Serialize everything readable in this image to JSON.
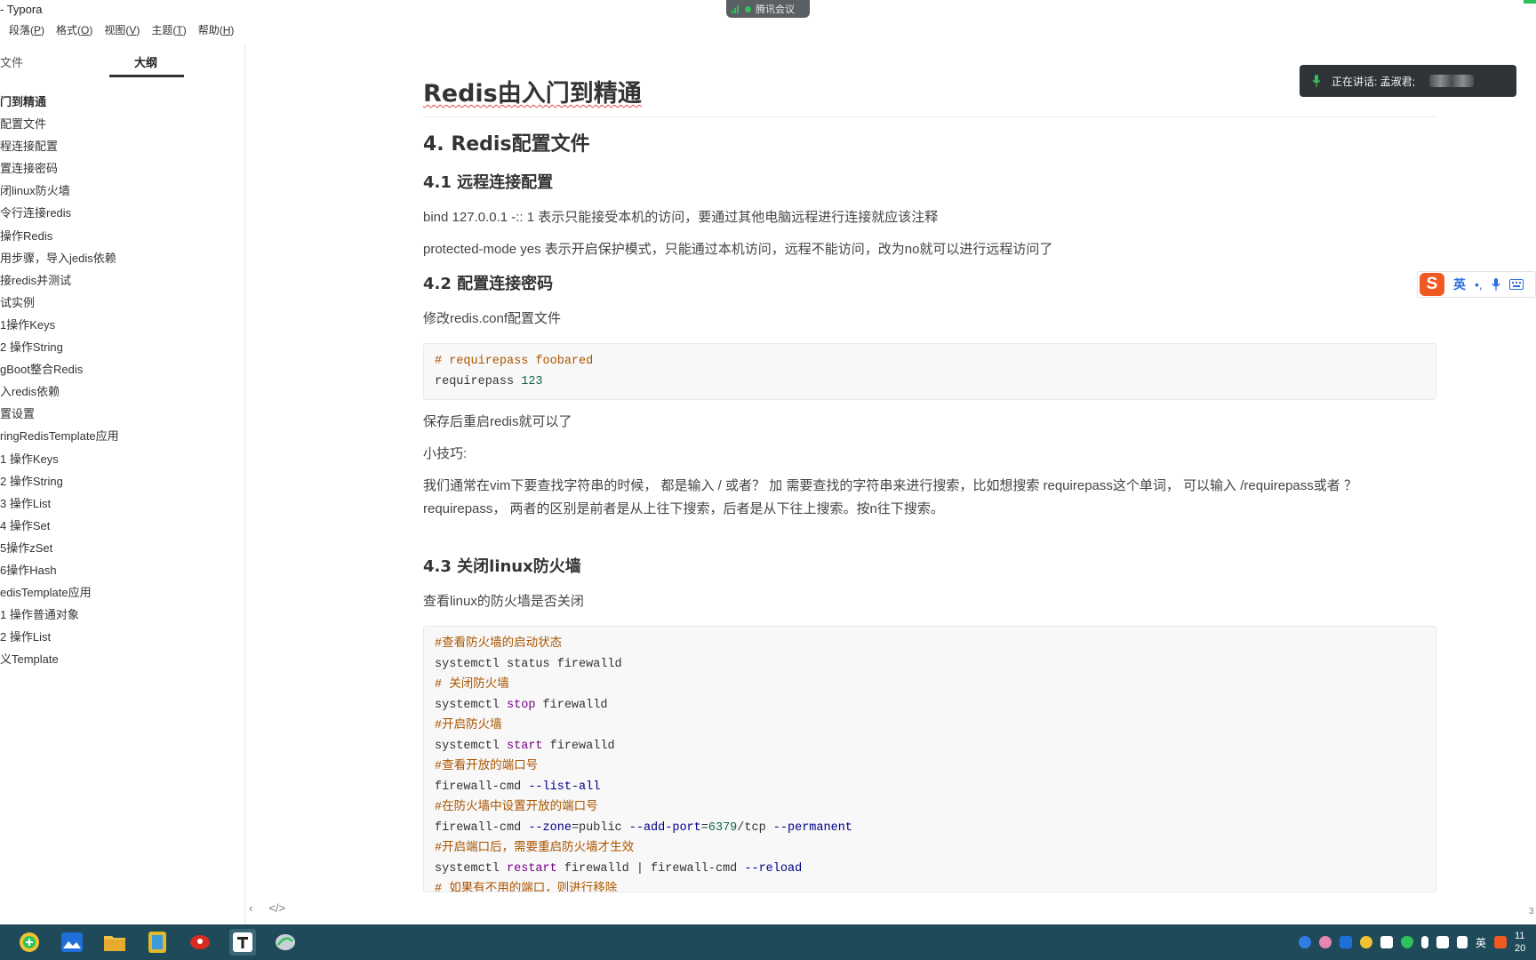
{
  "window": {
    "title": "- Typora"
  },
  "menu": [
    {
      "label": "段落(",
      "mnemonic": "P",
      "close": ")"
    },
    {
      "label": "格式(",
      "mnemonic": "O",
      "close": ")"
    },
    {
      "label": "视图(",
      "mnemonic": "V",
      "close": ")"
    },
    {
      "label": "主题(",
      "mnemonic": "T",
      "close": ")"
    },
    {
      "label": "帮助(",
      "mnemonic": "H",
      "close": ")"
    }
  ],
  "meeting": {
    "label": "腾讯会议",
    "speaking": "正在讲话: 孟淑君;"
  },
  "sidebar": {
    "tab_files": "文件",
    "tab_outline": "大纲",
    "outline": [
      {
        "label": "门到精通",
        "level": 1
      },
      {
        "label": "配置文件",
        "level": 2
      },
      {
        "label": "程连接配置",
        "level": 3
      },
      {
        "label": "置连接密码",
        "level": 3
      },
      {
        "label": "闭linux防火墙",
        "level": 3
      },
      {
        "label": "令行连接redis",
        "level": 3
      },
      {
        "label": "操作Redis",
        "level": 2
      },
      {
        "label": "用步骤，导入jedis依赖",
        "level": 3
      },
      {
        "label": "接redis并测试",
        "level": 3
      },
      {
        "label": "试实例",
        "level": 3
      },
      {
        "label": "1操作Keys",
        "level": 4
      },
      {
        "label": "2 操作String",
        "level": 4
      },
      {
        "label": "gBoot整合Redis",
        "level": 2
      },
      {
        "label": "入redis依赖",
        "level": 3
      },
      {
        "label": "置设置",
        "level": 3
      },
      {
        "label": "ringRedisTemplate应用",
        "level": 3
      },
      {
        "label": "1 操作Keys",
        "level": 4
      },
      {
        "label": "2 操作String",
        "level": 4
      },
      {
        "label": "3 操作List",
        "level": 4
      },
      {
        "label": "4 操作Set",
        "level": 4
      },
      {
        "label": "5操作zSet",
        "level": 4
      },
      {
        "label": "6操作Hash",
        "level": 4
      },
      {
        "label": "edisTemplate应用",
        "level": 3
      },
      {
        "label": "1 操作普通对象",
        "level": 4
      },
      {
        "label": "2 操作List",
        "level": 4
      },
      {
        "label": "义Template",
        "level": 3
      }
    ],
    "footer_left": "‹",
    "footer_right": "</>"
  },
  "doc": {
    "h1": "Redis由入门到精通",
    "h2": "4. Redis配置文件",
    "s41": "4.1 远程连接配置",
    "p_bind": "bind 127.0.0.1 -:: 1 表示只能接受本机的访问，要通过其他电脑远程进行连接就应该注释",
    "p_protected": "protected-mode yes 表示开启保护模式，只能通过本机访问，远程不能访问，改为no就可以进行远程访问了",
    "s42": "4.2 配置连接密码",
    "p_modify": "修改redis.conf配置文件",
    "code1": {
      "l1": "# requirepass foobared",
      "l2a": "requirepass ",
      "l2b": "123"
    },
    "p_restart": "保存后重启redis就可以了",
    "p_tip": "小技巧:",
    "p_vim": "我们通常在vim下要查找字符串的时候， 都是输入 / 或者？  加 需要查找的字符串来进行搜索，比如想搜索 requirepass这个单词， 可以输入  /requirepass或者 ？ requirepass，  两者的区别是前者是从上往下搜索，后者是从下往上搜索。按n往下搜索。",
    "s43": "4.3 关闭linux防火墙",
    "p_check": "查看linux的防火墙是否关闭",
    "code2": {
      "c1": "#查看防火墙的启动状态",
      "l1": "systemctl status firewalld",
      "c2": "# 关闭防火墙",
      "l2a": "systemctl ",
      "l2b": "stop",
      "l2c": " firewalld",
      "c3": "#开启防火墙",
      "l3a": "systemctl ",
      "l3b": "start",
      "l3c": " firewalld",
      "c4": "#查看开放的端口号",
      "l4a": "firewall-cmd ",
      "l4b": "--list-all",
      "c5": "#在防火墙中设置开放的端口号",
      "l5a": "firewall-cmd ",
      "l5b": "--zone",
      "l5c": "=public ",
      "l5d": "--add-port",
      "l5e": "=",
      "l5f": "6379",
      "l5g": "/tcp ",
      "l5h": "--permanent",
      "c6": "#开启端口后，需要重启防火墙才生效",
      "l6a": "systemctl ",
      "l6b": "restart",
      "l6c": " firewalld | firewall-cmd ",
      "l6d": "--reload",
      "c7": "# 如果有不用的端口，则进行移除"
    }
  },
  "ime": {
    "lang": "英",
    "punct": "•,",
    "mic": "mic-icon",
    "kbd": "keyboard-icon"
  },
  "taskbar": {
    "tray_lang": "英",
    "clock_time": "11",
    "clock_date": "20",
    "edge_num": "3"
  },
  "colors": {
    "comment": "#aa5500",
    "keyword": "#770088",
    "number": "#116644",
    "selection": "#d6e6f7",
    "taskbar": "#1f4a5a"
  }
}
